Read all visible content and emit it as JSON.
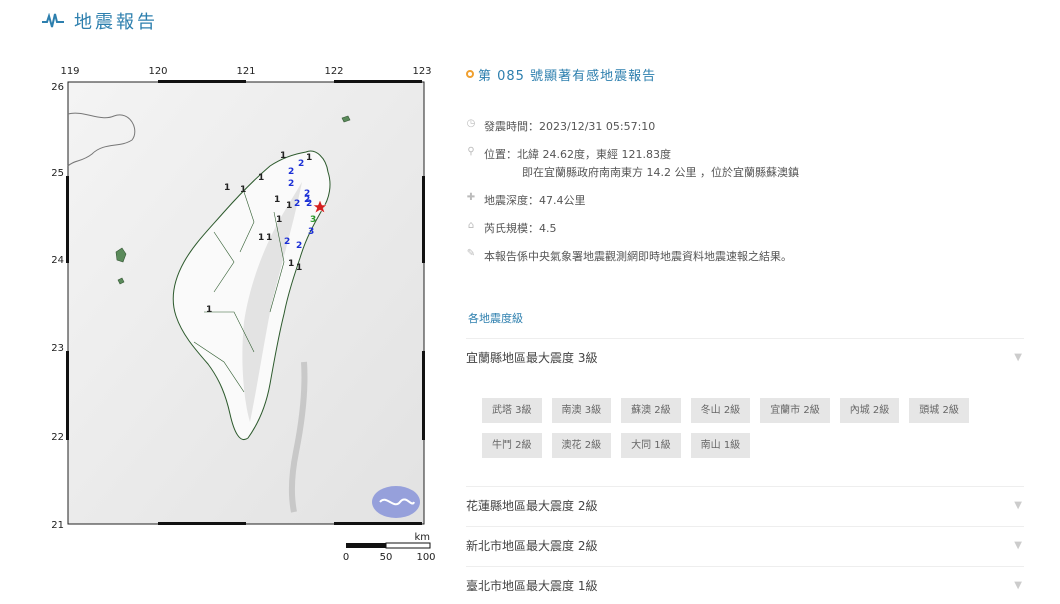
{
  "page_title": "地震報告",
  "map": {
    "lon_ticks": [
      "119",
      "120",
      "121",
      "122",
      "123"
    ],
    "lat_ticks": [
      "26",
      "25",
      "24",
      "23",
      "22",
      "21"
    ],
    "scale_unit": "km",
    "scale_labels": [
      "0",
      "50",
      "100"
    ],
    "intensity_labels": [
      {
        "v": "1",
        "c": "#222"
      },
      {
        "v": "1",
        "c": "#222"
      },
      {
        "v": "1",
        "c": "#222"
      },
      {
        "v": "1",
        "c": "#222"
      },
      {
        "v": "1",
        "c": "#222"
      },
      {
        "v": "2",
        "c": "#1a2fd6"
      },
      {
        "v": "2",
        "c": "#1a2fd6"
      },
      {
        "v": "2",
        "c": "#1a2fd6"
      },
      {
        "v": "2",
        "c": "#1a2fd6"
      },
      {
        "v": "2",
        "c": "#1a2fd6"
      },
      {
        "v": "2",
        "c": "#1a2fd6"
      },
      {
        "v": "1",
        "c": "#222"
      },
      {
        "v": "1",
        "c": "#222"
      },
      {
        "v": "1",
        "c": "#222"
      },
      {
        "v": "1",
        "c": "#222"
      },
      {
        "v": "2",
        "c": "#1a2fd6"
      },
      {
        "v": "2",
        "c": "#1a2fd6"
      },
      {
        "v": "3",
        "c": "#2a9a2a"
      },
      {
        "v": "3",
        "c": "#1a2fd6"
      },
      {
        "v": "2",
        "c": "#1a2fd6"
      },
      {
        "v": "1",
        "c": "#222"
      },
      {
        "v": "1",
        "c": "#222"
      },
      {
        "v": "1",
        "c": "#222"
      },
      {
        "v": "1",
        "c": "#222"
      }
    ]
  },
  "report": {
    "title": "第 085 號顯著有感地震報告",
    "time": "發震時間：2023/12/31 05:57:10",
    "location": "位置：北緯 24.62度，東經 121.83度",
    "location_detail": "即在宜蘭縣政府南南東方 14.2 公里 ，位於宜蘭縣蘇澳鎮",
    "depth": "地震深度：47.4公里",
    "magnitude": "芮氏規模：4.5",
    "note": "本報告係中央氣象署地震觀測網即時地震資料地震速報之結果。",
    "section_label": "各地震度級",
    "regions": [
      {
        "name": "宜蘭縣地區最大震度 3級"
      },
      {
        "name": "花蓮縣地區最大震度 2級"
      },
      {
        "name": "新北市地區最大震度 2級"
      },
      {
        "name": "臺北市地區最大震度 1級"
      }
    ],
    "tags": [
      "武塔 3級",
      "南澳 3級",
      "蘇澳 2級",
      "冬山 2級",
      "宜蘭市 2級",
      "內城 2級",
      "頭城 2級",
      "牛鬥 2級",
      "澳花 2級",
      "大同 1級",
      "南山 1級"
    ]
  },
  "colors": {
    "accent": "#2d7fae",
    "epicenter": "#d42020",
    "ring": "#f0a030"
  },
  "icons": [
    "pulse-icon",
    "clock-icon",
    "pin-icon",
    "depth-icon",
    "magnitude-icon",
    "note-icon",
    "chevron-down-icon"
  ]
}
